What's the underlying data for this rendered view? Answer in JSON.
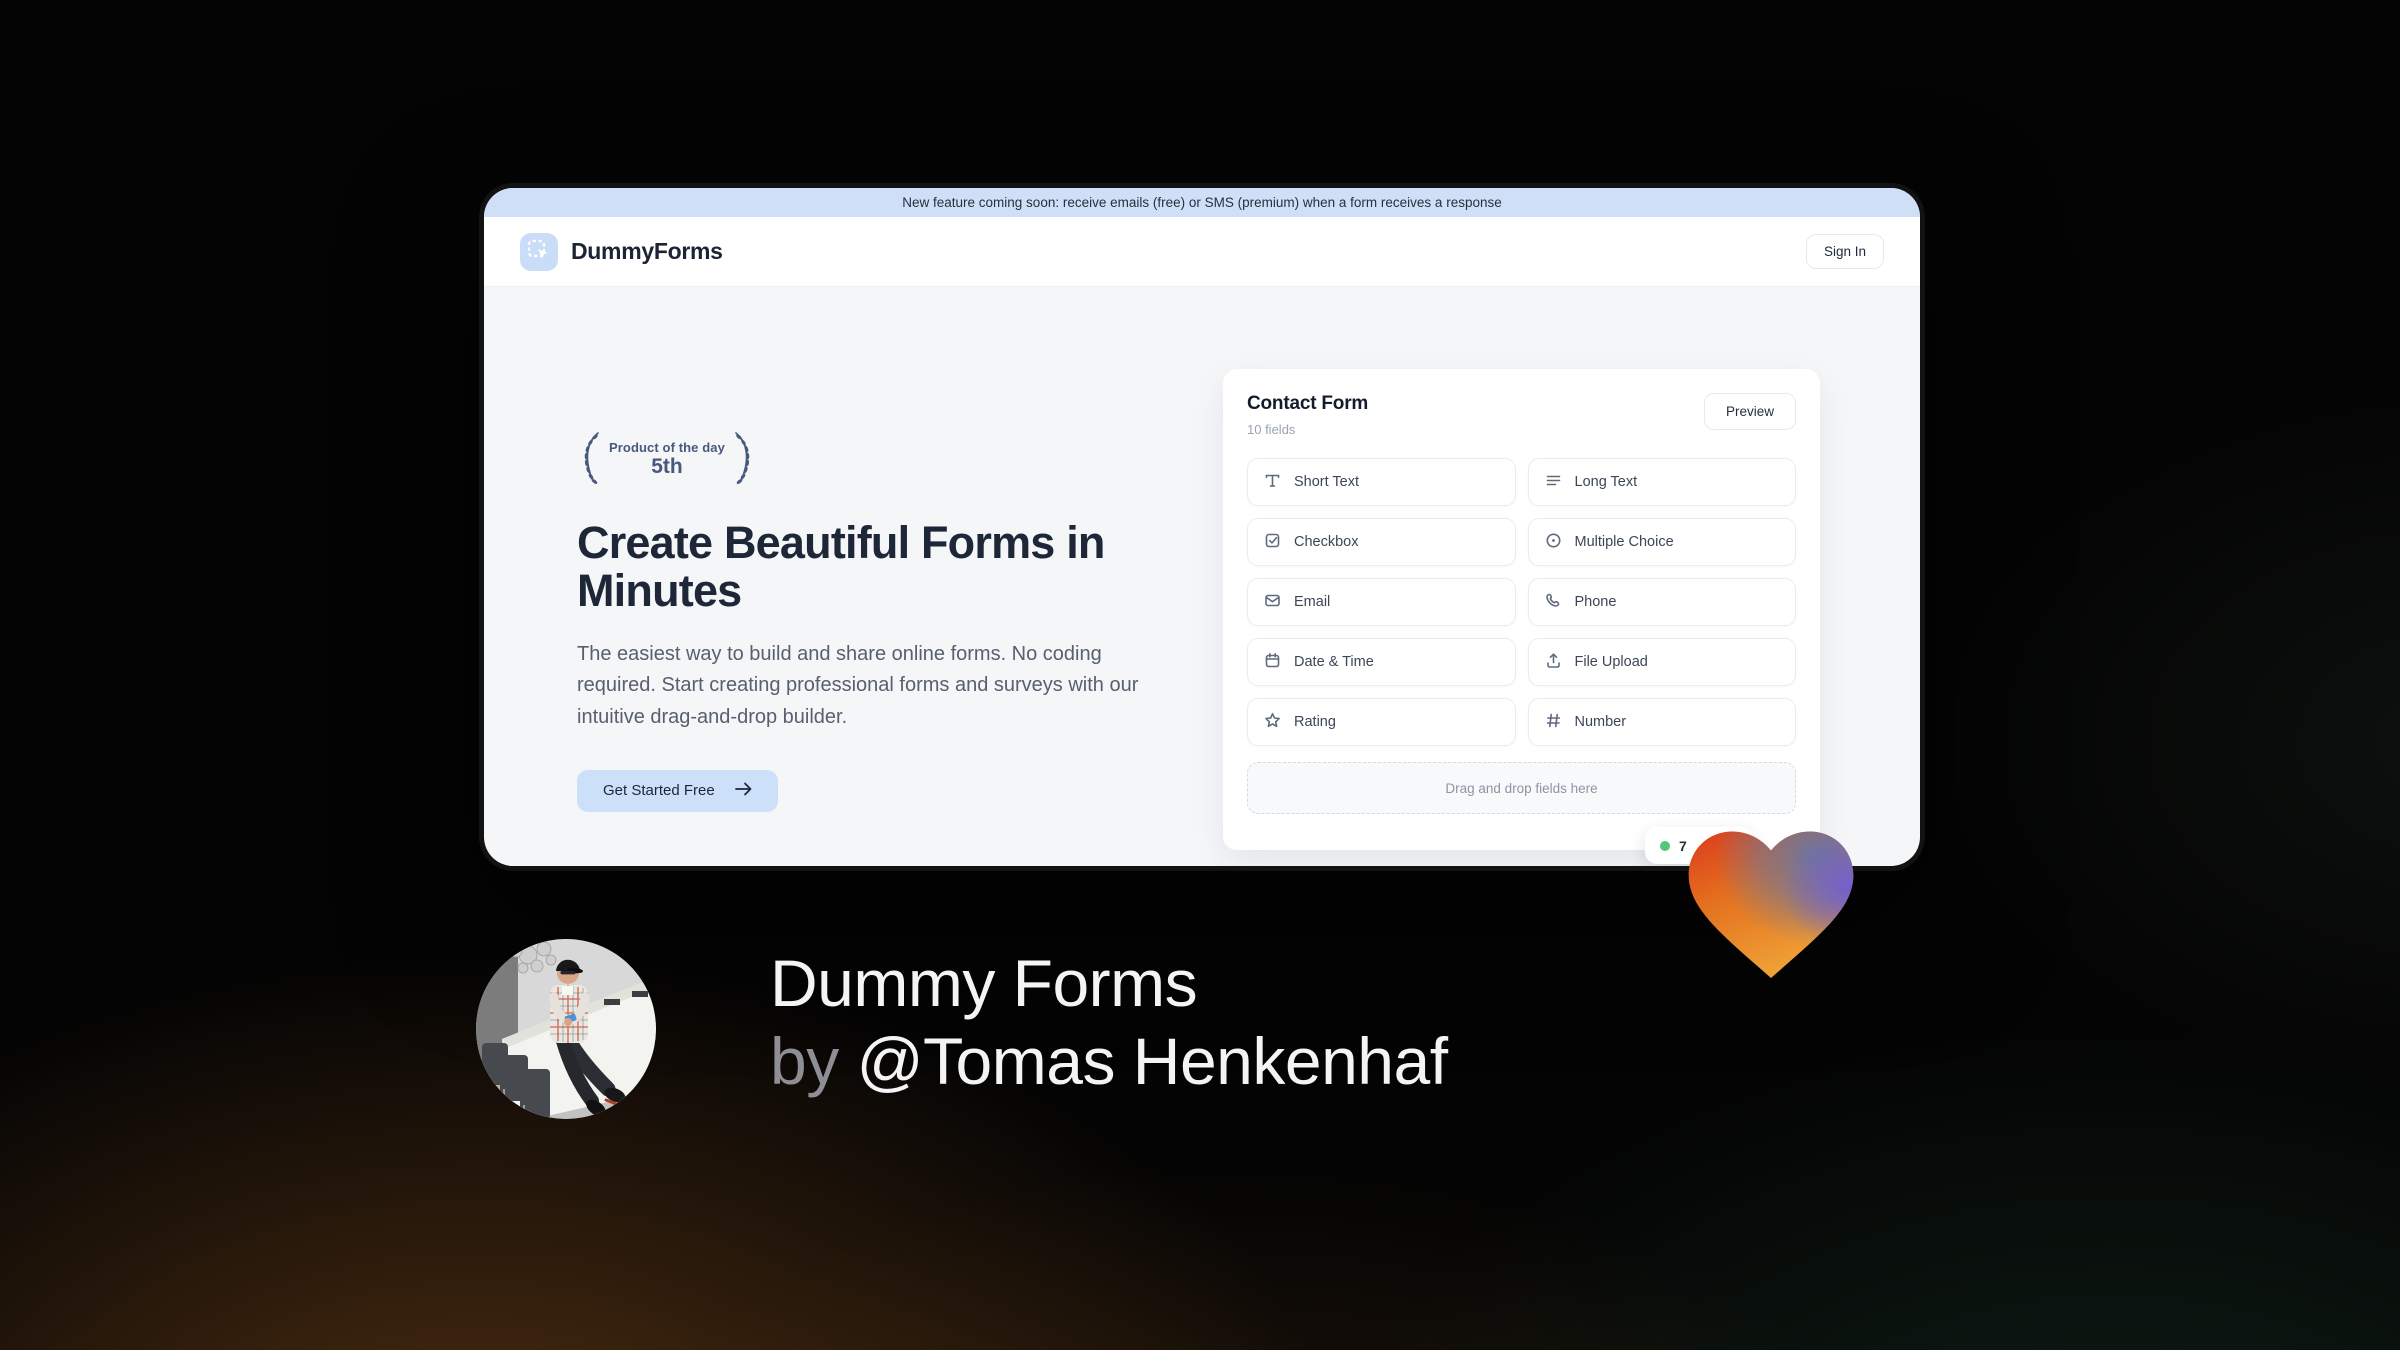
{
  "banner": {
    "text": "New feature coming soon: receive emails (free) or SMS (premium) when a form receives a response"
  },
  "header": {
    "brand": "DummyForms",
    "sign_in": "Sign In"
  },
  "hero": {
    "award": {
      "title": "Product of the day",
      "rank": "5th"
    },
    "heading": "Create Beautiful Forms in Minutes",
    "description": "The easiest way to build and share online forms. No coding required. Start creating professional forms and surveys with our intuitive drag-and-drop builder.",
    "cta": "Get Started Free"
  },
  "form_card": {
    "title": "Contact Form",
    "subtitle": "10 fields",
    "preview_button": "Preview",
    "fields": [
      {
        "label": "Short Text",
        "icon": "text-icon"
      },
      {
        "label": "Long Text",
        "icon": "lines-icon"
      },
      {
        "label": "Checkbox",
        "icon": "checkbox-icon"
      },
      {
        "label": "Multiple Choice",
        "icon": "radio-icon"
      },
      {
        "label": "Email",
        "icon": "envelope-icon"
      },
      {
        "label": "Phone",
        "icon": "phone-icon"
      },
      {
        "label": "Date & Time",
        "icon": "calendar-icon"
      },
      {
        "label": "File Upload",
        "icon": "upload-icon"
      },
      {
        "label": "Rating",
        "icon": "star-icon"
      },
      {
        "label": "Number",
        "icon": "hash-icon"
      }
    ],
    "dropzone": "Drag and drop fields here",
    "status_badge": "7"
  },
  "caption": {
    "line1": "Dummy Forms",
    "by": "by",
    "author": "@Tomas Henkenhaf"
  },
  "colors": {
    "banner_bg": "#cfdff7",
    "accent_blue": "#cde0f9",
    "brand_navy": "#1d2738",
    "laurel_blue": "#49587e",
    "green_dot": "#4fc878",
    "heart_red": "#dd3a1c",
    "heart_orange": "#f0a236",
    "heart_blue": "#67789f",
    "heart_purple": "#6f5ed6"
  }
}
